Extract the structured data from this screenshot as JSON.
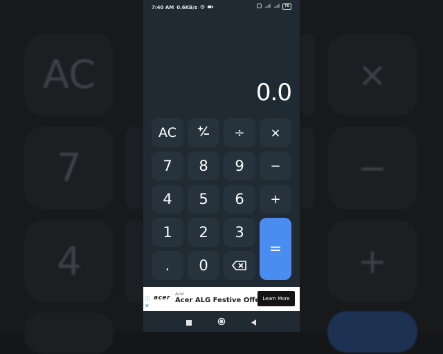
{
  "status_bar": {
    "time": "7:40 AM",
    "speed": "0.6KB/s",
    "network": "4G",
    "battery": "76"
  },
  "display": {
    "value": "0.0"
  },
  "keys": {
    "clear": "AC",
    "plus_minus": "⁺∕₋",
    "divide": "÷",
    "multiply": "×",
    "seven": "7",
    "eight": "8",
    "nine": "9",
    "minus": "−",
    "four": "4",
    "five": "5",
    "six": "6",
    "plus": "+",
    "one": "1",
    "two": "2",
    "three": "3",
    "equals": "=",
    "dot": ".",
    "zero": "0",
    "backspace_icon": "backspace-icon"
  },
  "ad": {
    "logo": "acer",
    "advertiser": "Acer",
    "headline": "Acer ALG Festive Offers",
    "cta": "Learn More"
  },
  "background": {
    "left_keys": [
      "AC",
      "7",
      "4"
    ],
    "right_keys": [
      "×",
      "−",
      "+"
    ]
  },
  "colors": {
    "phone_bg": "#1f2a33",
    "key_bg": "#26323c",
    "equals_bg": "#4a8df0"
  }
}
